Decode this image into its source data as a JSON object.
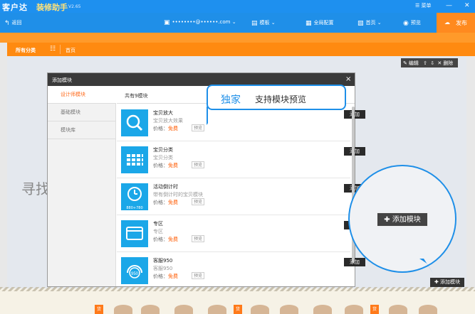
{
  "titlebar": {
    "logo": "客户达",
    "sub": "装修助手",
    "version": "V2.65",
    "menu": "菜单",
    "min": "—",
    "close": "✕"
  },
  "toolbar": {
    "back": "返回",
    "account": "••••••••@••••••.com",
    "template": "模板",
    "global": "全局配置",
    "home": "首页",
    "preview": "预览",
    "publish": "发布"
  },
  "navbar": {
    "all": "所有分类",
    "home": "首页"
  },
  "canvas": {
    "bgtext": "寻找"
  },
  "editbar": {
    "edit": "编辑",
    "up": "⇧",
    "down": "⇩",
    "delete": "删除"
  },
  "dialog": {
    "title": "添加模块",
    "close": "×",
    "sidebar": [
      {
        "label": "设计师模块",
        "active": true
      },
      {
        "label": "基础模块",
        "active": false
      },
      {
        "label": "模块库",
        "active": false
      }
    ],
    "count": "共有9模块",
    "items": [
      {
        "name": "宝贝放大",
        "desc": "宝贝放大效果",
        "price_label": "价格：",
        "price": "免费",
        "preview": "预览",
        "add": "添加",
        "icon": "search-icon"
      },
      {
        "name": "宝贝分类",
        "desc": "宝贝分类",
        "price_label": "价格：",
        "price": "免费",
        "preview": "预览",
        "add": "添加",
        "icon": "grid-icon"
      },
      {
        "name": "活动倒计时",
        "desc": "带有倒计时的宝贝模块",
        "price_label": "价格：",
        "price": "免费",
        "preview": "预览",
        "add": "添加",
        "icon": "clock-icon",
        "icon_text": "880+780"
      },
      {
        "name": "专区",
        "desc": "专区",
        "price_label": "价格：",
        "price": "免费",
        "preview": "预览",
        "add": "添加",
        "icon": "window-icon"
      },
      {
        "name": "客服950",
        "desc": "客服950",
        "price_label": "价格：",
        "price": "免费",
        "preview": "预览",
        "add": "添加",
        "icon": "headset-icon",
        "icon_text": "950"
      }
    ]
  },
  "callout": {
    "highlight": "独家",
    "text": "支持模块预览"
  },
  "circle": {
    "button": "添加模块"
  },
  "add_small": "添加模块",
  "bottom_tags": [
    "货",
    "货",
    "货"
  ],
  "colors": {
    "primary": "#1e8fe8",
    "orange": "#ff8a10",
    "free": "#ff5a00"
  }
}
